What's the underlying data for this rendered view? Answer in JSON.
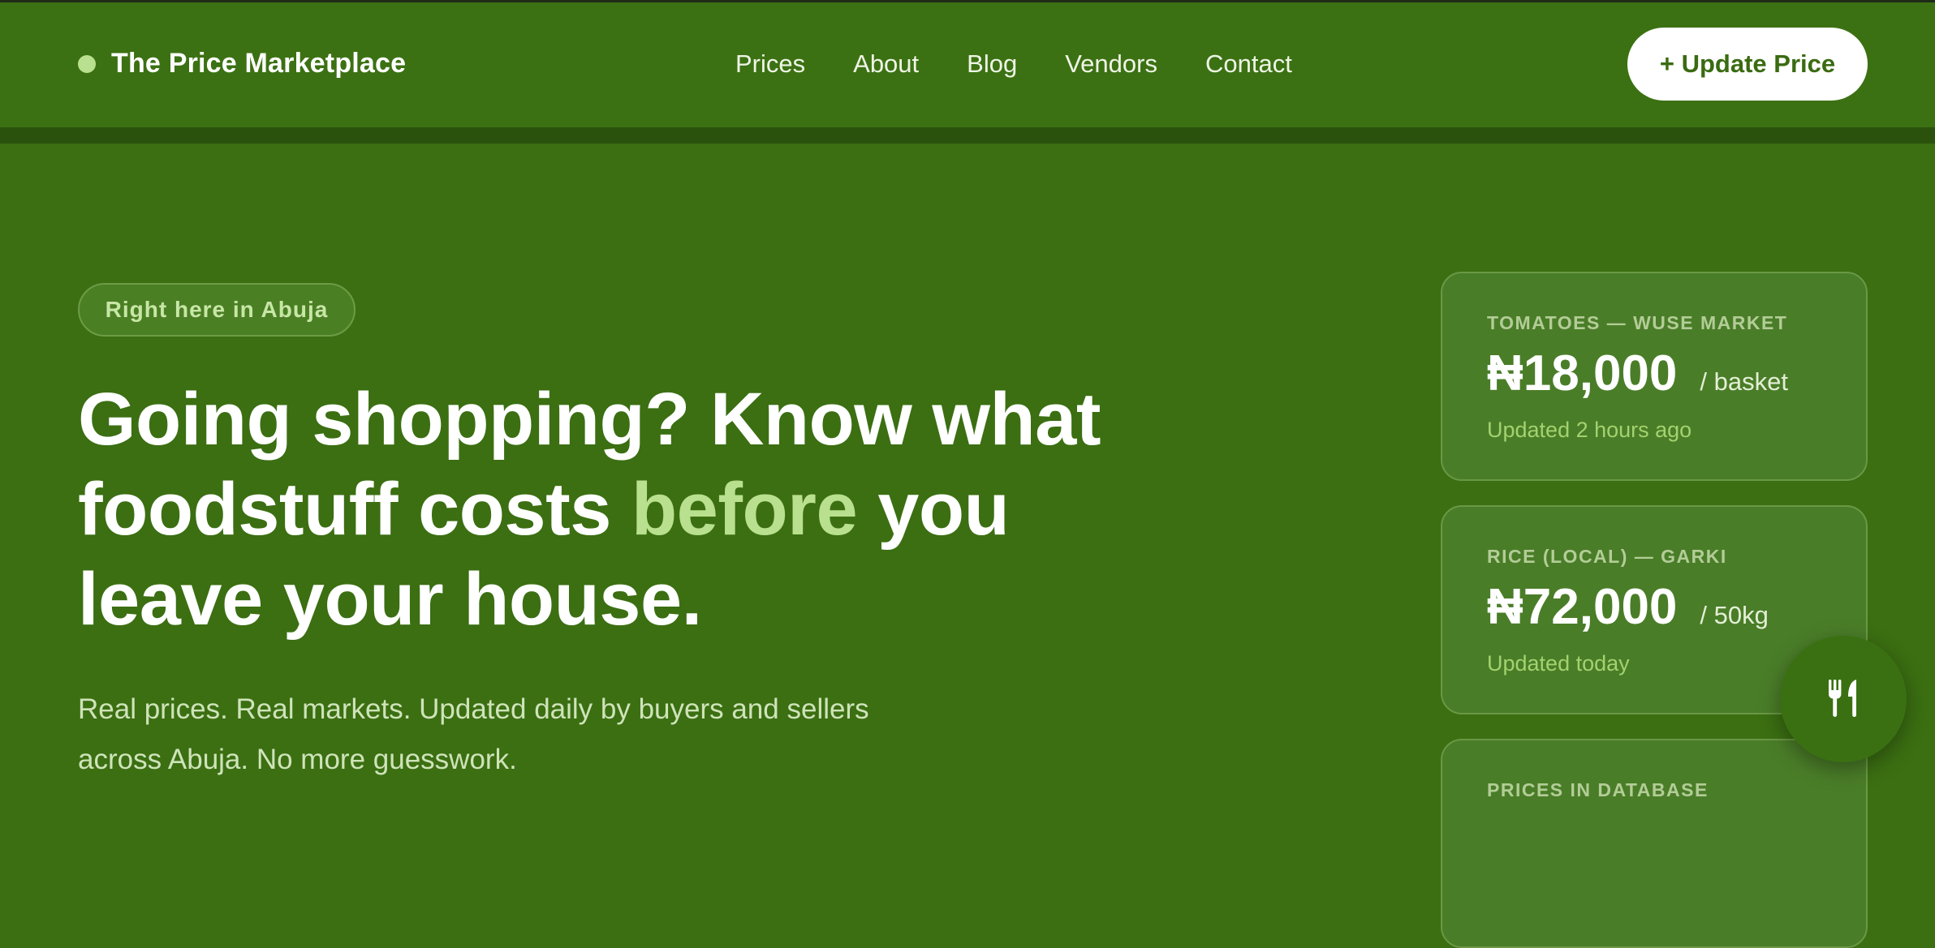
{
  "brand": {
    "name": "The Price Marketplace"
  },
  "nav": {
    "links": [
      "Prices",
      "About",
      "Blog",
      "Vendors",
      "Contact"
    ],
    "cta_label": "+ Update Price"
  },
  "hero": {
    "badge": "Right here in Abuja",
    "headline_part1": "Going shopping? Know what foodstuff costs ",
    "headline_accent": "before",
    "headline_part2": " you leave your house.",
    "subtext": "Real prices. Real markets. Updated daily by buyers and sellers across Abuja. No more guesswork."
  },
  "price_cards": [
    {
      "label": "TOMATOES — WUSE MARKET",
      "price": "₦18,000",
      "unit": "/ basket",
      "updated": "Updated 2 hours ago"
    },
    {
      "label": "RICE (LOCAL) — GARKI",
      "price": "₦72,000",
      "unit": "/ 50kg",
      "updated": "Updated today"
    },
    {
      "label": "PRICES IN DATABASE",
      "price": "",
      "unit": "",
      "updated": ""
    }
  ],
  "fab": {
    "icon": "fork-knife-icon"
  },
  "colors": {
    "background": "#3b6f12",
    "accent": "#b9e08e",
    "card": "#4a7d28",
    "updated_text": "#a3d26f"
  }
}
